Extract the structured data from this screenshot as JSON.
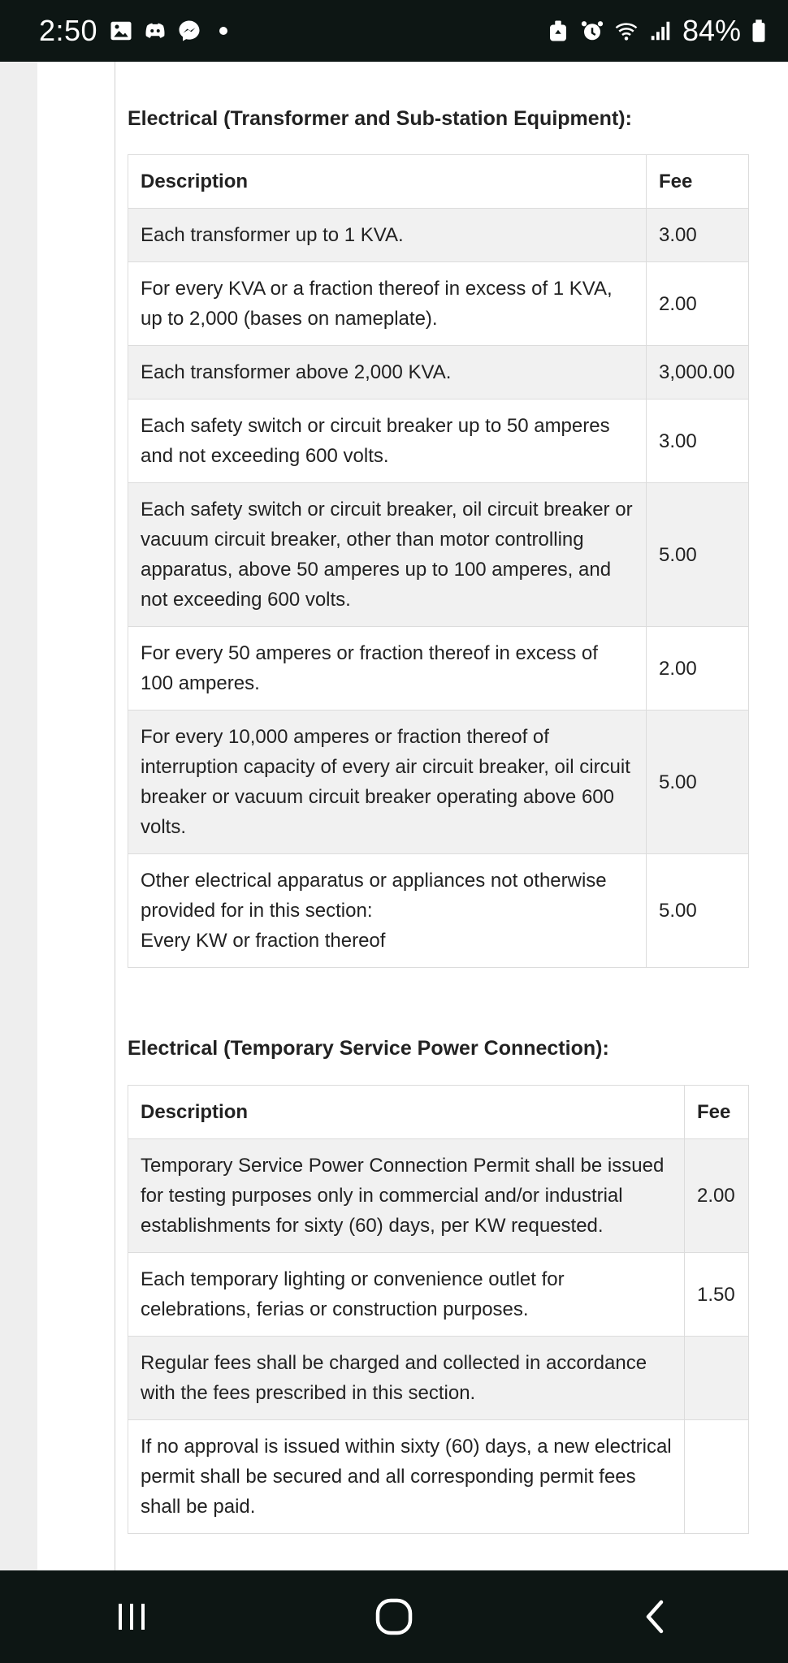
{
  "status_bar": {
    "time": "2:50",
    "battery": "84%",
    "icons": [
      "gallery-icon",
      "discord-icon",
      "messenger-icon",
      "notification-dot",
      "recycle-icon",
      "alarm-icon",
      "wifi-icon",
      "signal-icon",
      "battery-icon"
    ]
  },
  "section1": {
    "title": "Electrical (Transformer and Sub-station Equipment):",
    "headers": {
      "description": "Description",
      "fee": "Fee"
    },
    "rows": [
      {
        "description": "Each transformer up to 1 KVA.",
        "fee": "3.00"
      },
      {
        "description": "For every KVA or a fraction thereof in excess of 1 KVA, up to 2,000 (bases on nameplate).",
        "fee": "2.00"
      },
      {
        "description": "Each transformer above 2,000 KVA.",
        "fee": "3,000.00"
      },
      {
        "description": "Each safety switch or circuit breaker up to 50 amperes and not exceeding 600 volts.",
        "fee": "3.00"
      },
      {
        "description": "Each safety switch or circuit breaker, oil circuit breaker or vacuum circuit breaker, other than motor controlling apparatus, above 50 amperes up to 100 amperes, and not exceeding 600 volts.",
        "fee": "5.00"
      },
      {
        "description": "For every 50 amperes or fraction thereof in excess of 100 amperes.",
        "fee": "2.00"
      },
      {
        "description": "For every 10,000 amperes or fraction thereof of interruption capacity of every air circuit breaker, oil circuit breaker or vacuum circuit breaker operating above 600 volts.",
        "fee": "5.00"
      },
      {
        "description_line1": "Other electrical apparatus or appliances not otherwise provided for in this section:",
        "description_line2": "Every KW or fraction thereof",
        "fee": "5.00"
      }
    ]
  },
  "section2": {
    "title": "Electrical (Temporary Service Power Connection):",
    "headers": {
      "description": "Description",
      "fee": "Fee"
    },
    "rows": [
      {
        "description": "Temporary Service Power Connection Permit shall be issued for testing purposes only in commercial and/or industrial establishments for sixty (60) days, per KW requested.",
        "fee": "2.00"
      },
      {
        "description": "Each temporary lighting or convenience outlet for celebrations, ferias or construction purposes.",
        "fee": "1.50"
      },
      {
        "description": "Regular fees shall be charged and collected in accordance with the fees prescribed in this section.",
        "fee": ""
      },
      {
        "description": "If no approval is issued within sixty (60) days, a new electrical permit shall be secured and all corresponding permit fees shall be paid.",
        "fee": ""
      }
    ]
  },
  "nav_bar": {
    "buttons": [
      "recent-apps-button",
      "home-button",
      "back-button"
    ]
  }
}
